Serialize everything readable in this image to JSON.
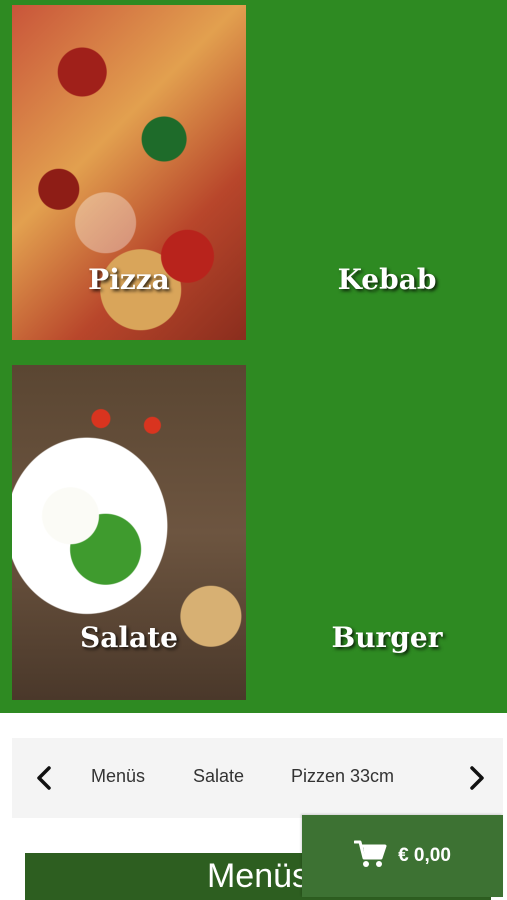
{
  "categories": [
    {
      "label": "Pizza"
    },
    {
      "label": "Kebab"
    },
    {
      "label": "Salate"
    },
    {
      "label": "Burger"
    }
  ],
  "carousel": {
    "items": [
      "Menüs",
      "Salate",
      "Pizzen 33cm"
    ],
    "prev_icon": "chevron-left-icon",
    "next_icon": "chevron-right-icon"
  },
  "section": {
    "title": "Menüs"
  },
  "cart": {
    "icon": "shopping-cart-icon",
    "total": "€ 0,00"
  },
  "colors": {
    "brand_green": "#2e8a22",
    "dark_green": "#2d5e20",
    "cart_green": "#3d7233"
  }
}
